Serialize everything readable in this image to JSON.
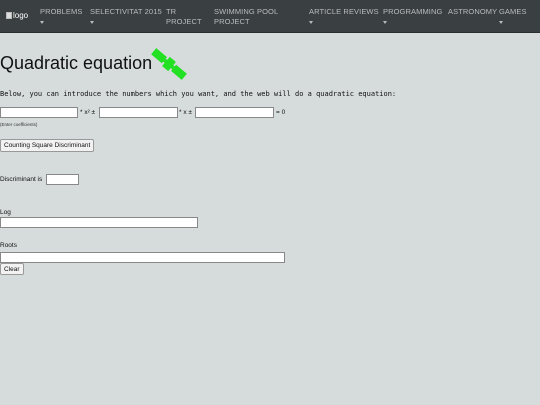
{
  "nav": {
    "logo_alt": "logo",
    "items": [
      {
        "label_line1": "PROBLEMS",
        "label_line2": ""
      },
      {
        "label_line1": "SELECTIVITAT 2015",
        "label_line2": ""
      },
      {
        "label_line1": "TR",
        "label_line2": "PROJECT"
      },
      {
        "label_line1": "SWIMMING POOL",
        "label_line2": "PROJECT"
      },
      {
        "label_line1": "ARTICLE REVIEWS",
        "label_line2": ""
      },
      {
        "label_line1": "PROGRAMMING",
        "label_line2": ""
      },
      {
        "label_line1": "ASTRONOMY",
        "label_line2": ""
      },
      {
        "label_line1": "GAMES",
        "label_line2": ""
      }
    ]
  },
  "page": {
    "title": "Quadratic equation",
    "intro": "Below, you can introduce the numbers which you want, and the web will do a quadratic equation:",
    "coef_a_label": "* x² ±",
    "coef_b_label": "* x ±",
    "coef_c_label": "= 0",
    "coef_hint": "(Enter coefficients)",
    "coef_a_value": "",
    "coef_b_value": "",
    "coef_c_value": "",
    "discriminant_button": "Counting Square Discriminant",
    "discriminant_label": "Discriminant is",
    "discriminant_value": "",
    "log_label": "Log",
    "log_value": "",
    "roots_label": "Roots",
    "roots_value": "",
    "clear_button": "Clear"
  },
  "colors": {
    "nav_bg": "#3a3f41",
    "page_bg": "#d5dcdb",
    "satellite": "#22e022"
  },
  "icons": {
    "satellite": "satellite-icon"
  }
}
